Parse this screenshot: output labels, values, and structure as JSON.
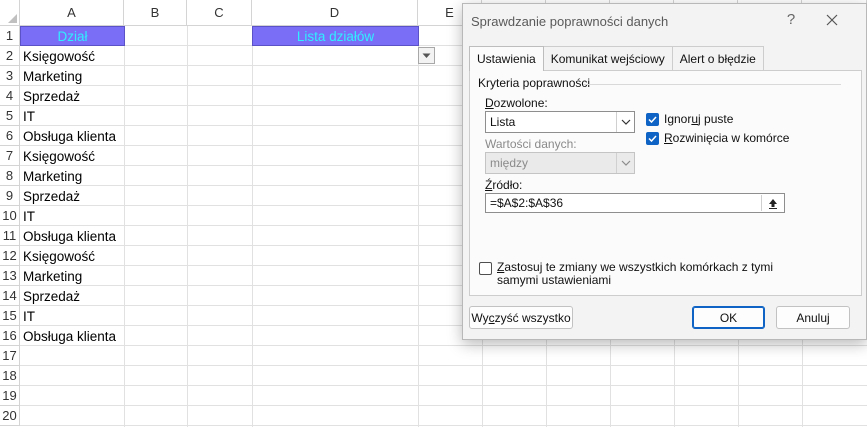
{
  "sheet": {
    "columns": [
      "A",
      "B",
      "C",
      "D",
      "E"
    ],
    "rows": [
      "1",
      "2",
      "3",
      "4",
      "5",
      "6",
      "7",
      "8",
      "9",
      "10",
      "11",
      "12",
      "13",
      "14",
      "15",
      "16",
      "17",
      "18",
      "19",
      "20"
    ],
    "header_cells": {
      "a1": "Dział",
      "d1": "Lista działów"
    },
    "column_a": [
      "Księgowość",
      "Marketing",
      "Sprzedaż",
      "IT",
      "Obsługa klienta",
      "Księgowość",
      "Marketing",
      "Sprzedaż",
      "IT",
      "Obsługa klienta",
      "Księgowość",
      "Marketing",
      "Sprzedaż",
      "IT",
      "Obsługa klienta"
    ],
    "header_fill_color": "#7b6ef6",
    "header_text_color": "#2ff0ff",
    "dropdown_icon": "chevron-down-icon"
  },
  "dialog": {
    "title": "Sprawdzanie poprawności danych",
    "help_glyph": "?",
    "tabs": [
      "Ustawienia",
      "Komunikat wejściowy",
      "Alert o błędzie"
    ],
    "group_label": "Kryteria poprawności",
    "allow_label_pre": "",
    "allow_label_ul": "D",
    "allow_label_post": "ozwolone:",
    "allow_value": "Lista",
    "data_label": "Wartości danych:",
    "data_value": "między",
    "ignore_blank_pre": "Ignor",
    "ignore_blank_ul": "u",
    "ignore_blank_post": "j puste",
    "in_cell_dropdown_pre": "",
    "in_cell_dropdown_ul": "R",
    "in_cell_dropdown_post": "ozwinięcia w komórce",
    "source_label_pre": "",
    "source_label_ul": "Ź",
    "source_label_post": "ródło:",
    "source_value": "=$A$2:$A$36",
    "apply_pre": "",
    "apply_ul": "Z",
    "apply_post": "astosuj te zmiany we wszystkich komórkach z tymi samymi ustawieniami",
    "clear_pre": "Wy",
    "clear_ul": "c",
    "clear_post": "zyść wszystko",
    "ok_label": "OK",
    "cancel_label": "Anuluj",
    "accent_color": "#0e63c4"
  }
}
